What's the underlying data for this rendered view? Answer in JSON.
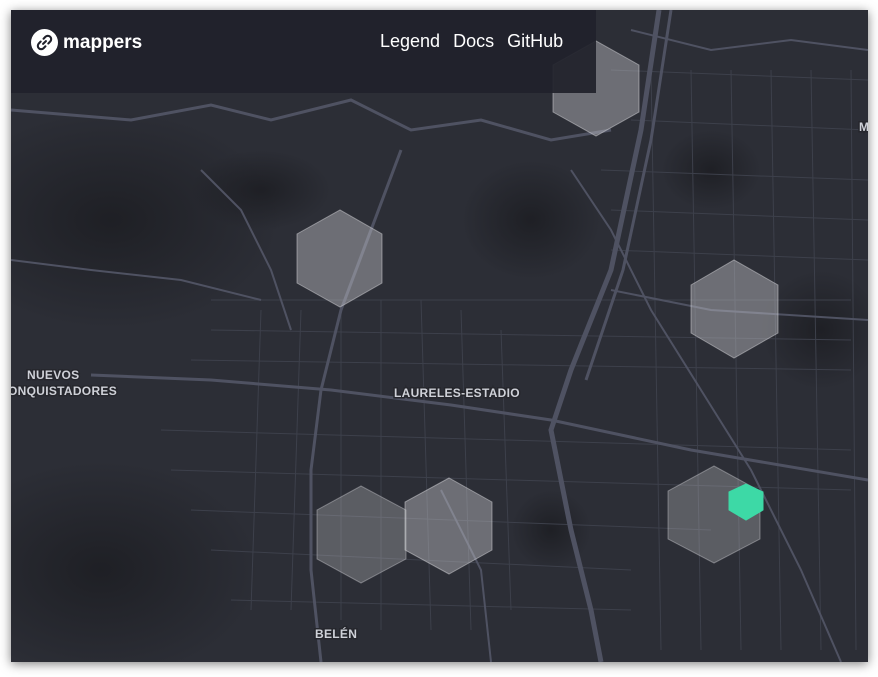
{
  "app": {
    "name": "mappers"
  },
  "nav": {
    "links": [
      "Legend",
      "Docs",
      "GitHub"
    ]
  },
  "map": {
    "labels": {
      "nuevos": "NUEVOS",
      "conquistadores": "ONQUISTADORES",
      "laureles": "LAURELES-ESTADIO",
      "belen": "BELÉN",
      "edge": "M"
    }
  },
  "colors": {
    "background": "#2c2e36",
    "navbar": "#20212b",
    "hexagon_fill": "#c9c9cc",
    "highlight": "#3dd9a6"
  },
  "icons": {
    "logo": "link-chain-icon"
  }
}
